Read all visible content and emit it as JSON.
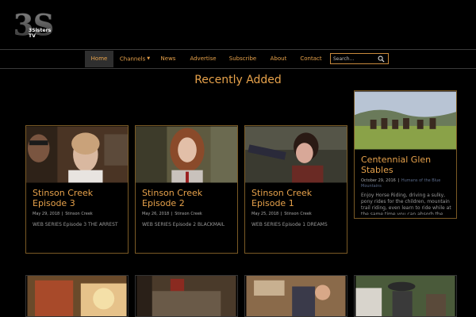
{
  "logo": {
    "text": "3Sisters TV"
  },
  "nav": {
    "items": [
      {
        "label": "Home"
      },
      {
        "label": "Channels"
      },
      {
        "label": "News"
      },
      {
        "label": "Advertise"
      },
      {
        "label": "Subscribe"
      },
      {
        "label": "About"
      },
      {
        "label": "Contact"
      }
    ]
  },
  "search": {
    "placeholder": "Search..."
  },
  "section": {
    "title": "Recently Added"
  },
  "cards": [
    {
      "title": "Stinson Creek Episode 3",
      "date": "May 29, 2018",
      "category": "Stinson Creek",
      "excerpt": "WEB SERIES Episode 3 THE ARREST"
    },
    {
      "title": "Stinson Creek Episode 2",
      "date": "May 26, 2018",
      "category": "Stinson Creek",
      "excerpt": "WEB SERIES Episode 2 BLACKMAIL"
    },
    {
      "title": "Stinson Creek Episode 1",
      "date": "May 25, 2018",
      "category": "Stinson Creek",
      "excerpt": "WEB SERIES Episode 1 DREAMS"
    }
  ],
  "feature": {
    "title": "Centennial Glen Stables",
    "date": "October 29, 2016",
    "category": "Humans of the Blue Mountains",
    "excerpt": "Enjoy Horse Riding, driving a sulky, pony rides for the children, mountain trail riding, even learn to ride while at the same time you can absorb the"
  },
  "colors": {
    "accent": "#e7a24b",
    "border": "#7a5a25",
    "background": "#000000"
  }
}
